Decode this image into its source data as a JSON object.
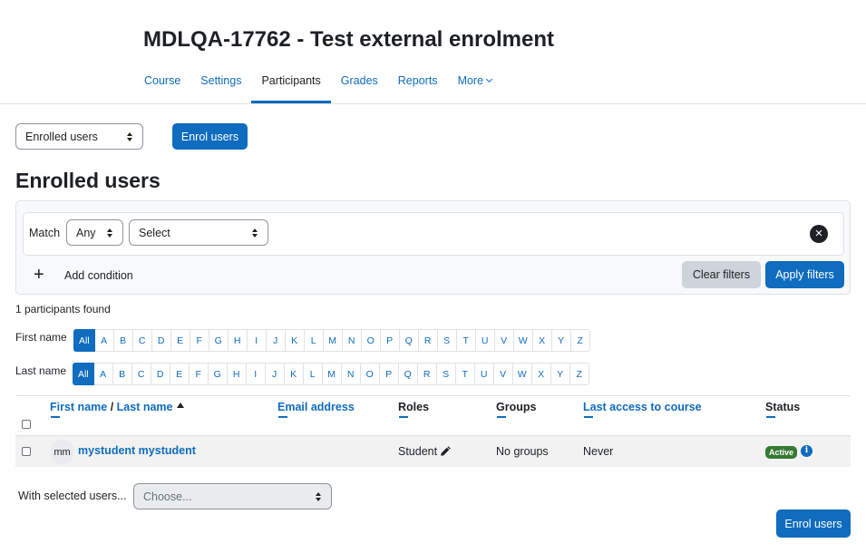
{
  "course": {
    "title": "MDLQA-17762 - Test external enrolment"
  },
  "nav": {
    "items": [
      {
        "label": "Course"
      },
      {
        "label": "Settings"
      },
      {
        "label": "Participants"
      },
      {
        "label": "Grades"
      },
      {
        "label": "Reports"
      },
      {
        "label": "More"
      }
    ],
    "active": "Participants"
  },
  "toolbar": {
    "view_select": "Enrolled users",
    "enrol_button": "Enrol users"
  },
  "page": {
    "heading": "Enrolled users"
  },
  "filters": {
    "match_label": "Match",
    "match_value": "Any",
    "type_placeholder": "Select",
    "add_condition": "Add condition",
    "clear": "Clear filters",
    "apply": "Apply filters"
  },
  "results": {
    "found": "1 participants found"
  },
  "initials": {
    "first_label": "First name",
    "last_label": "Last name",
    "all": "All",
    "letters": [
      "A",
      "B",
      "C",
      "D",
      "E",
      "F",
      "G",
      "H",
      "I",
      "J",
      "K",
      "L",
      "M",
      "N",
      "O",
      "P",
      "Q",
      "R",
      "S",
      "T",
      "U",
      "V",
      "W",
      "X",
      "Y",
      "Z"
    ]
  },
  "table": {
    "headers": {
      "first_name": "First name",
      "separator": "/",
      "last_name": "Last name",
      "email": "Email address",
      "roles": "Roles",
      "groups": "Groups",
      "last_access": "Last access to course",
      "status": "Status"
    },
    "rows": [
      {
        "initials": "mm",
        "name": "mystudent mystudent",
        "email": "",
        "role": "Student",
        "groups": "No groups",
        "last_access": "Never",
        "status": "Active"
      }
    ]
  },
  "bulk": {
    "label": "With selected users...",
    "placeholder": "Choose...",
    "enrol_button": "Enrol users"
  },
  "colors": {
    "primary": "#0f6cbf",
    "success": "#357a32",
    "text": "#1d2125",
    "border": "#dee2e6"
  }
}
